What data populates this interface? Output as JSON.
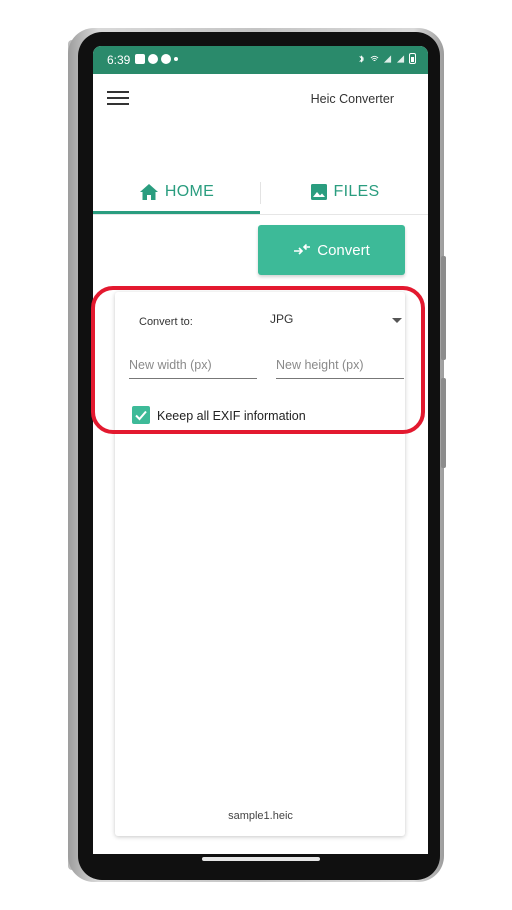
{
  "status_bar": {
    "time": "6:39"
  },
  "app": {
    "title": "Heic Converter"
  },
  "tabs": [
    {
      "label": "HOME",
      "icon": "home-icon"
    },
    {
      "label": "FILES",
      "icon": "image-icon"
    }
  ],
  "convert_button": {
    "label": "Convert",
    "icon": "swap-arrows-icon"
  },
  "form": {
    "convert_to_label": "Convert to:",
    "format_selected": "JPG",
    "width_placeholder": "New width (px)",
    "height_placeholder": "New height (px)",
    "width_value": "",
    "height_value": "",
    "exif_checked": true,
    "exif_label": "Keeep all EXIF information"
  },
  "file": {
    "name": "sample1.heic"
  },
  "colors": {
    "status_bar": "#2a8a6b",
    "accent": "#2a9d7f",
    "button": "#3dba98",
    "highlight": "#e3192f"
  }
}
